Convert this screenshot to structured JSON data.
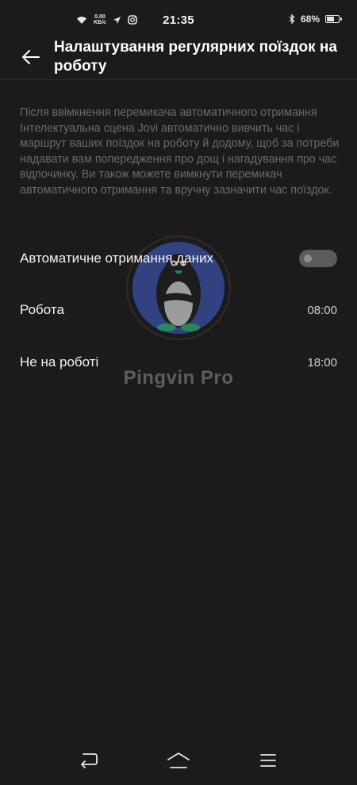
{
  "status_bar": {
    "speed_value": "0.00",
    "speed_unit": "KБ/с",
    "time": "21:35",
    "battery": "68%",
    "battery_level": 0.68,
    "icons": [
      "wifi-icon",
      "data-speed",
      "location-arrow-icon",
      "instagram-icon",
      "bluetooth-icon",
      "battery-icon"
    ]
  },
  "header": {
    "title": "Налаштування регулярних поїздок на роботу",
    "back_icon": "back-arrow-icon"
  },
  "description": "Після ввімкнення перемикача автоматичного отримання Інтелектуальна сцена Jovi автоматично вивчить час і маршрут ваших поїздок на роботу й додому, щоб за потреби надавати вам попередження про дощ і нагадування про час відпочинку. Ви також можете вимкнути перемикач автоматичного отримання та вручну зазначити час поїздок.",
  "settings": {
    "auto_data": {
      "label": "Автоматичне отримання даних",
      "enabled": false
    },
    "work": {
      "label": "Робота",
      "value": "08:00"
    },
    "off_work": {
      "label": "Не на роботі",
      "value": "18:00"
    }
  },
  "watermark": {
    "text": "Pingvin Pro"
  },
  "nav_bar": {
    "icons": [
      "back-nav-icon",
      "home-nav-icon",
      "menu-nav-icon"
    ]
  },
  "colors": {
    "background": "#1b1b1b",
    "text_primary": "#ffffff",
    "text_secondary": "#6b6b6b",
    "toggle_off": "#5b5b5b"
  }
}
